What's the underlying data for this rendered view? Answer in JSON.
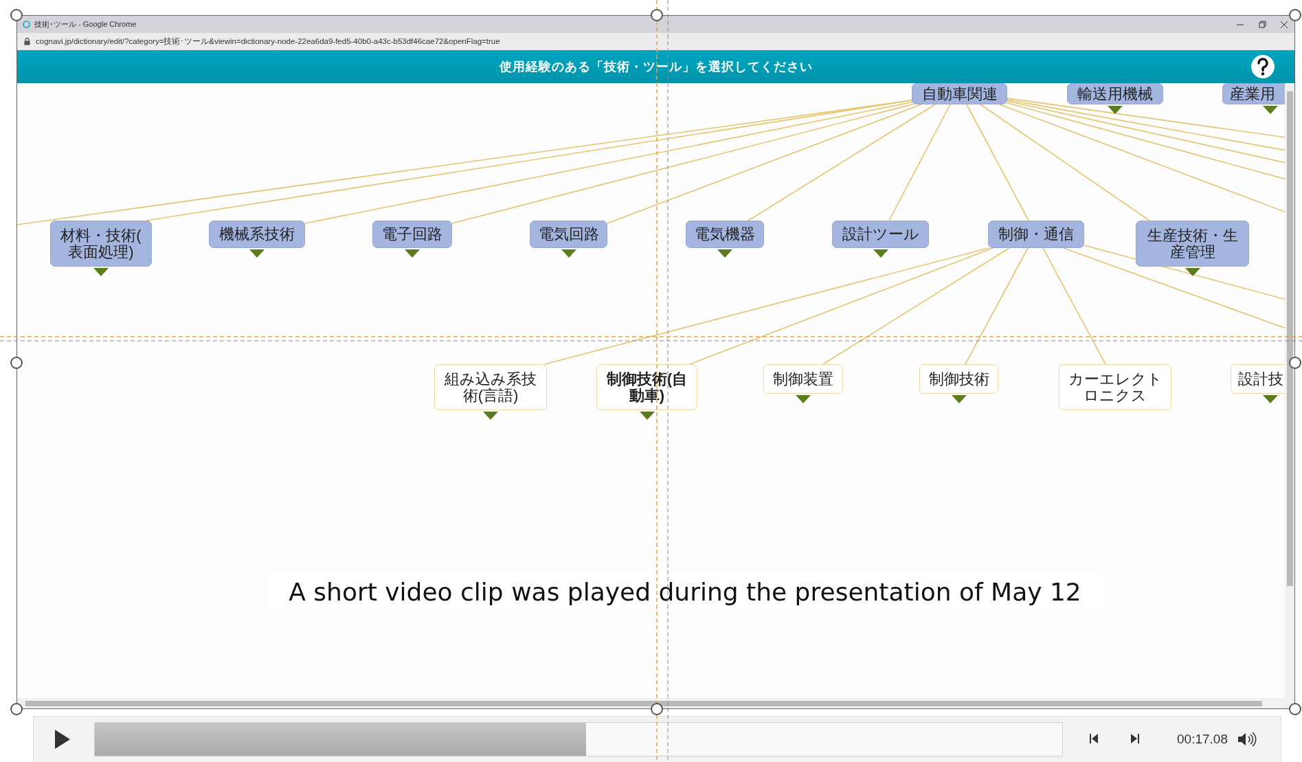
{
  "window": {
    "title": "技術･ツール - Google Chrome",
    "url": "cognavi.jp/dictionary/edit/?category=技術･ツール&viewin=dictionary-node-22ea6da9-fed5-40b0-a43c-b53df46cae72&openFlag=true"
  },
  "header": {
    "title": "使用経験のある「技術・ツール」を選択してください"
  },
  "nodes": [
    {
      "label": "自動車関連",
      "kind": "category",
      "collapsed": false,
      "selected": false
    },
    {
      "label": "輸送用機械",
      "kind": "category",
      "collapsed": true,
      "selected": false
    },
    {
      "label": "産業用",
      "kind": "category",
      "collapsed": true,
      "selected": false
    },
    {
      "label": "材料・技術(表面処理)",
      "kind": "category",
      "collapsed": true,
      "selected": false
    },
    {
      "label": "機械系技術",
      "kind": "category",
      "collapsed": true,
      "selected": false
    },
    {
      "label": "電子回路",
      "kind": "category",
      "collapsed": true,
      "selected": false
    },
    {
      "label": "電気回路",
      "kind": "category",
      "collapsed": true,
      "selected": false
    },
    {
      "label": "電気機器",
      "kind": "category",
      "collapsed": true,
      "selected": false
    },
    {
      "label": "設計ツール",
      "kind": "category",
      "collapsed": true,
      "selected": false
    },
    {
      "label": "制御・通信",
      "kind": "category",
      "collapsed": false,
      "selected": false
    },
    {
      "label": "生産技術・生産管理",
      "kind": "category",
      "collapsed": true,
      "selected": false
    },
    {
      "label": "組み込み系技術(言語)",
      "kind": "item",
      "collapsed": true,
      "selected": false
    },
    {
      "label": "制御技術(自動車)",
      "kind": "item",
      "collapsed": true,
      "selected": true
    },
    {
      "label": "制御装置",
      "kind": "item",
      "collapsed": true,
      "selected": false
    },
    {
      "label": "制御技術",
      "kind": "item",
      "collapsed": true,
      "selected": false
    },
    {
      "label": "カーエレクトロニクス",
      "kind": "item",
      "collapsed": false,
      "selected": false
    },
    {
      "label": "設計技",
      "kind": "item",
      "collapsed": true,
      "selected": false
    }
  ],
  "caption": "A short video clip was played during the presentation of May 12",
  "player": {
    "playing": false,
    "level": 0.508,
    "time": "00:17.08"
  }
}
